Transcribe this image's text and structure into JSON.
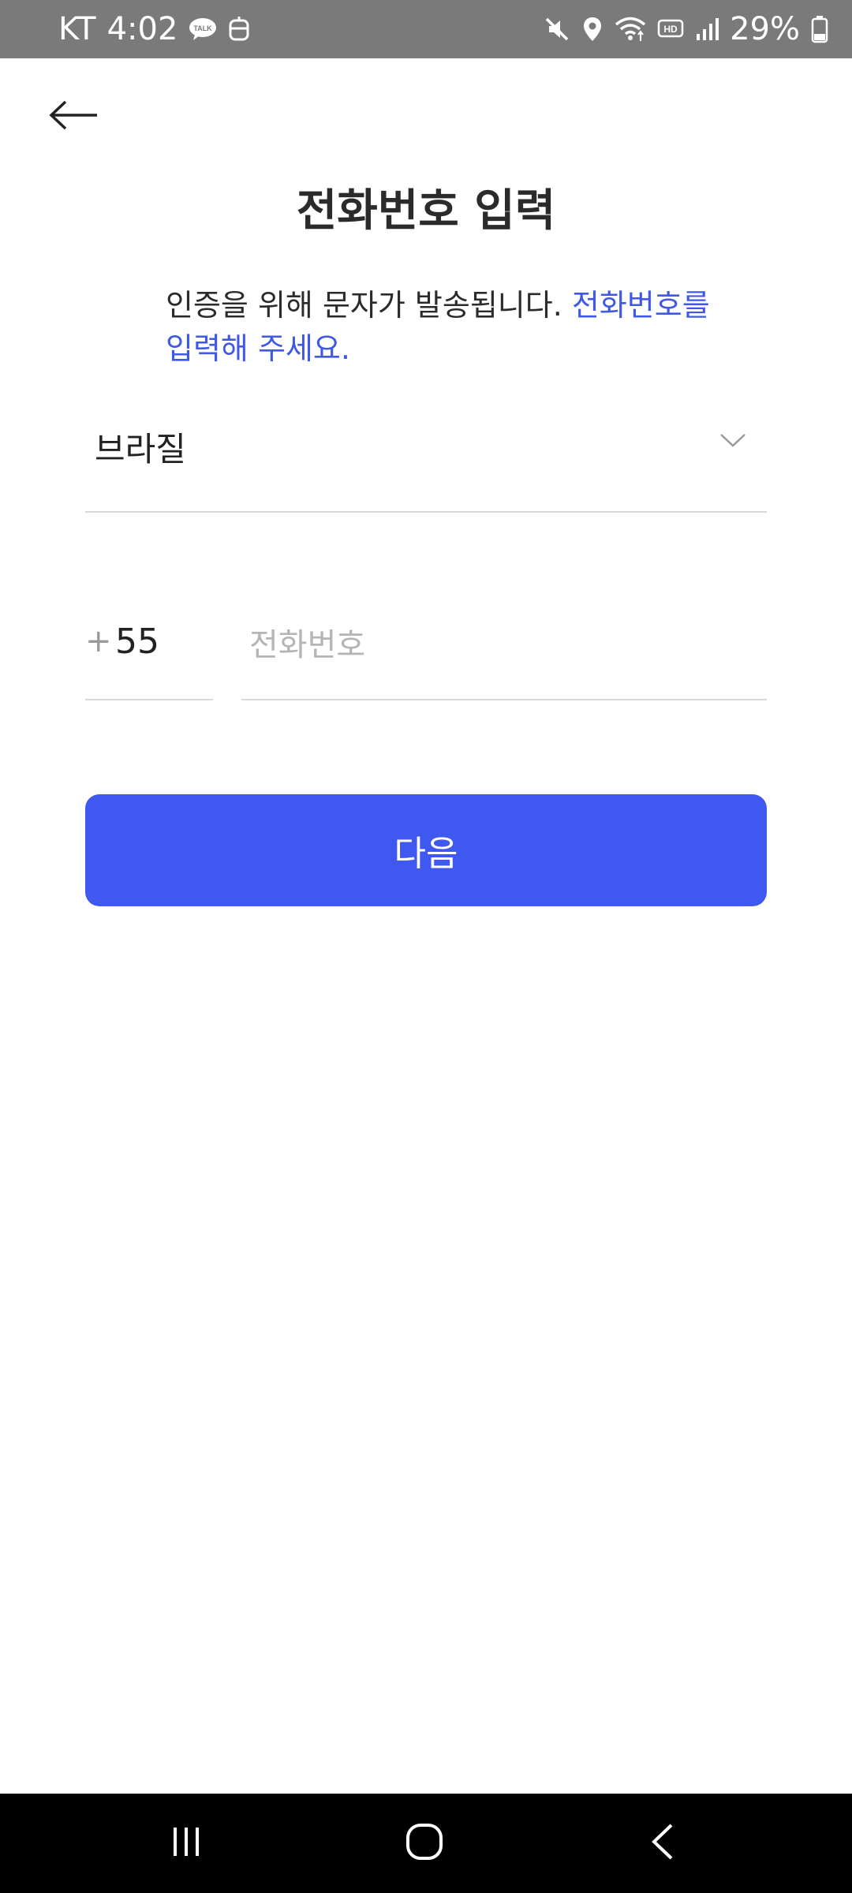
{
  "status_bar": {
    "carrier": "KT",
    "time": "4:02",
    "left_icons": [
      "kakaotalk-icon",
      "bot-icon"
    ],
    "right_icons": [
      "mute-icon",
      "location-icon",
      "wifi-icon",
      "hd-icon",
      "signal-icon"
    ],
    "battery_percent": "29%",
    "background": "#7a7a7a"
  },
  "header": {
    "back_icon": "arrow-left-icon",
    "title": "전화번호 입력"
  },
  "description": {
    "plain": "인증을 위해 문자가 발송됩니다. ",
    "highlight": "전화번호를 입력해 주세요.",
    "highlight_color": "#3f58e8"
  },
  "country_select": {
    "selected": "브라질",
    "icon": "chevron-down-icon"
  },
  "phone": {
    "plus": "+",
    "country_code": "55",
    "placeholder": "전화번호",
    "value": ""
  },
  "next_button": {
    "label": "다음",
    "color": "#3f58f0"
  },
  "nav_bar": {
    "icons": [
      "recent-apps-icon",
      "home-icon",
      "back-icon"
    ]
  }
}
